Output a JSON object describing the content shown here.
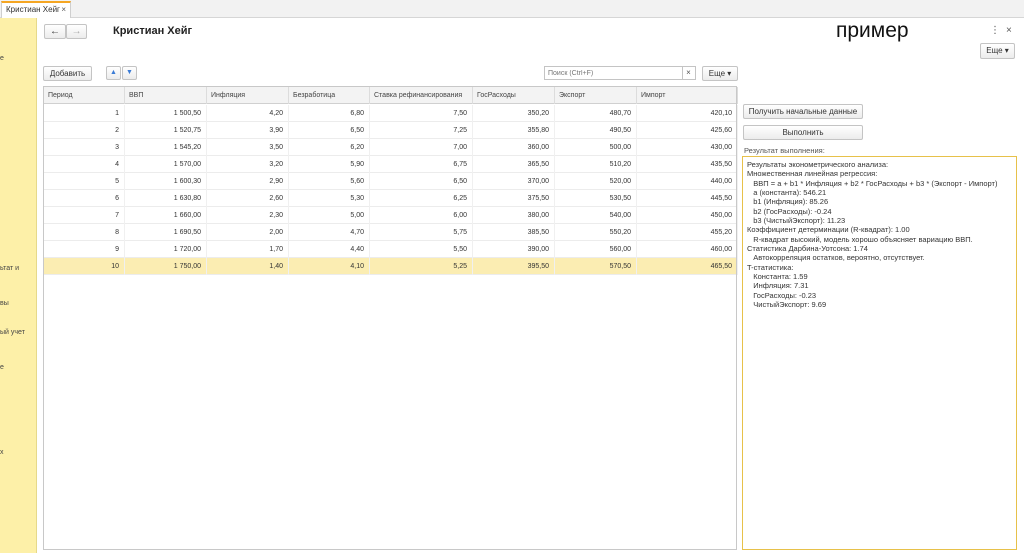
{
  "tab": {
    "title": "Кристиан Хейг",
    "close": "×"
  },
  "sidebar": {
    "fragments": [
      "е",
      "ьтат и",
      "вы",
      "ый учет",
      "е",
      "х"
    ]
  },
  "toolbar": {
    "back": "←",
    "forward": "→",
    "title": "Кристиан Хейг",
    "heading": "пример",
    "menu_dots": "⋮",
    "close": "×",
    "more_top": "Еще ▾"
  },
  "commands": {
    "add": "Добавить",
    "up": "▲",
    "down": "▼",
    "search_placeholder": "Поиск (Ctrl+F)",
    "search_clear": "×",
    "more": "Еще ▾"
  },
  "table": {
    "columns": [
      "Период",
      "ВВП",
      "Инфляция",
      "Безработица",
      "Ставка рефинансирования",
      "ГосРасходы",
      "Экспорт",
      "Импорт"
    ],
    "rows": [
      [
        "1",
        "1 500,50",
        "4,20",
        "6,80",
        "7,50",
        "350,20",
        "480,70",
        "420,10"
      ],
      [
        "2",
        "1 520,75",
        "3,90",
        "6,50",
        "7,25",
        "355,80",
        "490,50",
        "425,60"
      ],
      [
        "3",
        "1 545,20",
        "3,50",
        "6,20",
        "7,00",
        "360,00",
        "500,00",
        "430,00"
      ],
      [
        "4",
        "1 570,00",
        "3,20",
        "5,90",
        "6,75",
        "365,50",
        "510,20",
        "435,50"
      ],
      [
        "5",
        "1 600,30",
        "2,90",
        "5,60",
        "6,50",
        "370,00",
        "520,00",
        "440,00"
      ],
      [
        "6",
        "1 630,80",
        "2,60",
        "5,30",
        "6,25",
        "375,50",
        "530,50",
        "445,50"
      ],
      [
        "7",
        "1 660,00",
        "2,30",
        "5,00",
        "6,00",
        "380,00",
        "540,00",
        "450,00"
      ],
      [
        "8",
        "1 690,50",
        "2,00",
        "4,70",
        "5,75",
        "385,50",
        "550,20",
        "455,20"
      ],
      [
        "9",
        "1 720,00",
        "1,70",
        "4,40",
        "5,50",
        "390,00",
        "560,00",
        "460,00"
      ],
      [
        "10",
        "1 750,00",
        "1,40",
        "4,10",
        "5,25",
        "395,50",
        "570,50",
        "465,50"
      ]
    ],
    "selected_row": 9
  },
  "actions": {
    "get_data": "Получить начальные данные",
    "execute": "Выполнить",
    "result_label": "Результат выполнения:"
  },
  "result": {
    "lines": [
      "Результаты эконометрического анализа:",
      "Множественная линейная регрессия:",
      "   ВВП = a + b1 * Инфляция + b2 * ГосРасходы + b3 * (Экспорт - Импорт)",
      "   a (константа): 546.21",
      "   b1 (Инфляция): 85.26",
      "   b2 (ГосРасходы): -0.24",
      "   b3 (ЧистыйЭкспорт): 11.23",
      "Коэффициент детерминации (R-квадрат): 1.00",
      "   R-квадрат высокий, модель хорошо объясняет вариацию ВВП.",
      "Статистика Дарбина-Уотсона: 1.74",
      "   Автокорреляция остатков, вероятно, отсутствует.",
      "T-статистика:",
      "   Константа: 1.59",
      "   Инфляция: 7.31",
      "   ГосРасходы: -0.23",
      "   ЧистыйЭкспорт: 9.69"
    ]
  }
}
